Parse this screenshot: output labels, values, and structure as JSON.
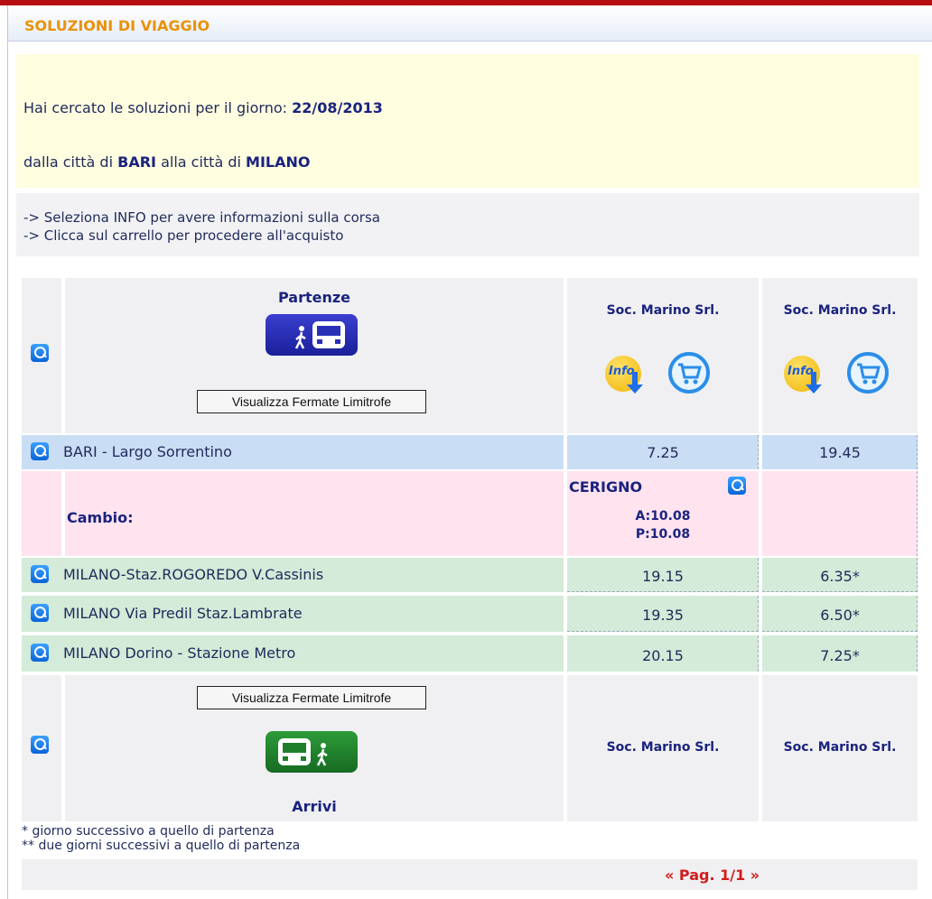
{
  "header": {
    "title": "SOLUZIONI DI VIAGGIO"
  },
  "search_summary": {
    "date_prefix": "Hai cercato le soluzioni per il giorno:",
    "date": "22/08/2013",
    "from_prefix": "dalla città di",
    "from_city": "BARI",
    "to_prefix": "alla città di",
    "to_city": "MILANO"
  },
  "instructions": [
    "-> Seleziona INFO per avere informazioni sulla corsa",
    "-> Clicca sul carrello per procedere all'acquisto"
  ],
  "table": {
    "departures_label": "Partenze",
    "arrivals_label": "Arrivi",
    "nearby_stops_button": "Visualizza Fermate Limitrofe",
    "info_label": "Info",
    "columns": [
      {
        "company": "Soc. Marino Srl."
      },
      {
        "company": "Soc. Marino Srl."
      }
    ],
    "departure_stop": {
      "name": "BARI - Largo Sorrentino",
      "times": [
        "7.25",
        "19.45"
      ]
    },
    "change": {
      "label": "Cambio:",
      "city": "CERIGNO",
      "arrival": "A:10.08",
      "departure": "P:10.08"
    },
    "arrival_stops": [
      {
        "name": "MILANO-Staz.ROGOREDO V.Cassinis",
        "times": [
          "19.15",
          "6.35*"
        ]
      },
      {
        "name": "MILANO Via Predil Staz.Lambrate",
        "times": [
          "19.35",
          "6.50*"
        ]
      },
      {
        "name": "MILANO Dorino - Stazione Metro",
        "times": [
          "20.15",
          "7.25*"
        ]
      }
    ]
  },
  "footnotes": [
    "* giorno successivo a quello di partenza",
    "** due giorni successivi a quello di partenza"
  ],
  "pagination": "« Pag. 1/1 »",
  "colors": {
    "title": "#e8920a",
    "topbar": "#b50f12",
    "departure_row": "#c9def5",
    "change_row": "#ffe3ef",
    "arrival_row": "#d3ebd8",
    "pagination": "#d31b1b"
  }
}
